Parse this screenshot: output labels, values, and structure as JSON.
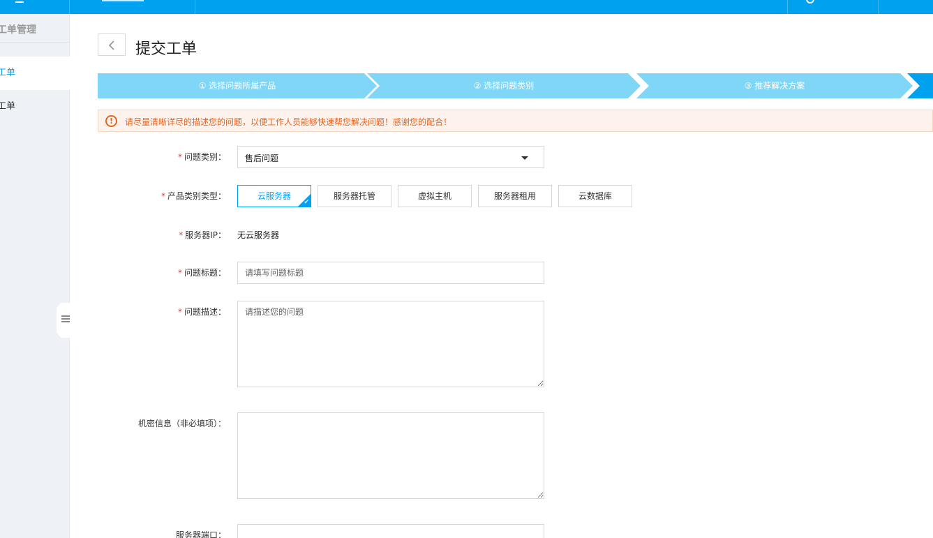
{
  "sidebar": {
    "title": "工单管理",
    "items": [
      {
        "label": "工单",
        "active": true
      },
      {
        "label": "工单",
        "active": false
      }
    ]
  },
  "header": {
    "title": "提交工单"
  },
  "steps": [
    {
      "label": "① 选择问题所属产品"
    },
    {
      "label": "② 选择问题类别"
    },
    {
      "label": "③ 推荐解决方案"
    }
  ],
  "notice": {
    "icon": "!",
    "text": "请尽量清晰详尽的描述您的问题，以便工作人员能够快速帮您解决问题！感谢您的配合！"
  },
  "form": {
    "category": {
      "label": "问题类别：",
      "value": "售后问题"
    },
    "product_type": {
      "label": "产品类别类型：",
      "options": [
        "云服务器",
        "服务器托管",
        "虚拟主机",
        "服务器租用",
        "云数据库"
      ],
      "selected": "云服务器"
    },
    "server_ip": {
      "label": "服务器IP：",
      "value": "无云服务器"
    },
    "title": {
      "label": "问题标题：",
      "placeholder": "请填写问题标题"
    },
    "description": {
      "label": "问题描述：",
      "placeholder": "请描述您的问题"
    },
    "secret": {
      "label": "机密信息（非必填项）："
    },
    "port": {
      "label": "服务器端口："
    }
  },
  "colors": {
    "primary": "#00a2f0",
    "step_light": "#7fd6f7",
    "warning": "#e8621e",
    "required": "#e4393c"
  }
}
